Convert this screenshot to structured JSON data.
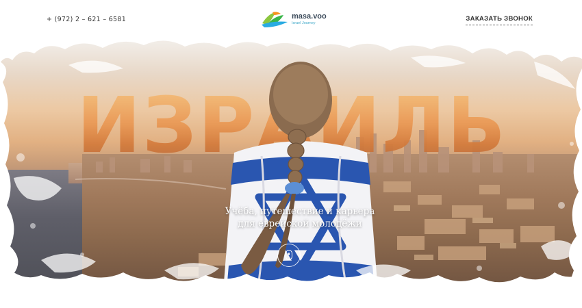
{
  "header": {
    "phone": "+ (972) 2 – 621 – 6581",
    "logo_name": "masa.voo",
    "logo_sub": "Israel Journey",
    "callback_label": "ЗАКАЗАТЬ ЗВОНОК"
  },
  "hero": {
    "title": "ИЗРАИЛЬ",
    "subtitle_line1": "Учёба, путешествие и карьера",
    "subtitle_line2": "для еврейской молодёжи"
  },
  "icons": {
    "logo": "masa-leaf-logo-icon",
    "scroll": "mouse-scroll-icon"
  },
  "colors": {
    "title_orange": "#eb9a55",
    "flag_blue": "#1f4fa3",
    "text_dark": "#333333"
  }
}
